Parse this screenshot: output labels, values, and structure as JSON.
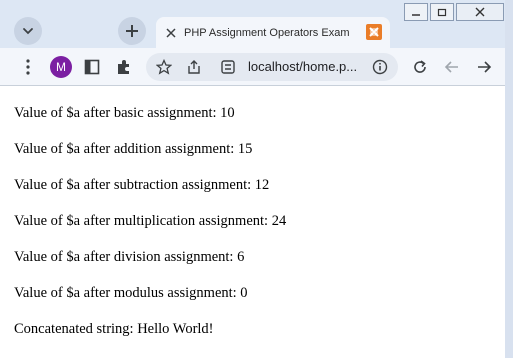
{
  "tab": {
    "title": "PHP Assignment Operators Exam"
  },
  "address": {
    "url": "localhost/home.p..."
  },
  "profile": {
    "initial": "M"
  },
  "output": {
    "lines": [
      "Value of $a after basic assignment: 10",
      "Value of $a after addition assignment: 15",
      "Value of $a after subtraction assignment: 12",
      "Value of $a after multiplication assignment: 24",
      "Value of $a after division assignment: 6",
      "Value of $a after modulus assignment: 0",
      "Concatenated string: Hello World!"
    ]
  }
}
